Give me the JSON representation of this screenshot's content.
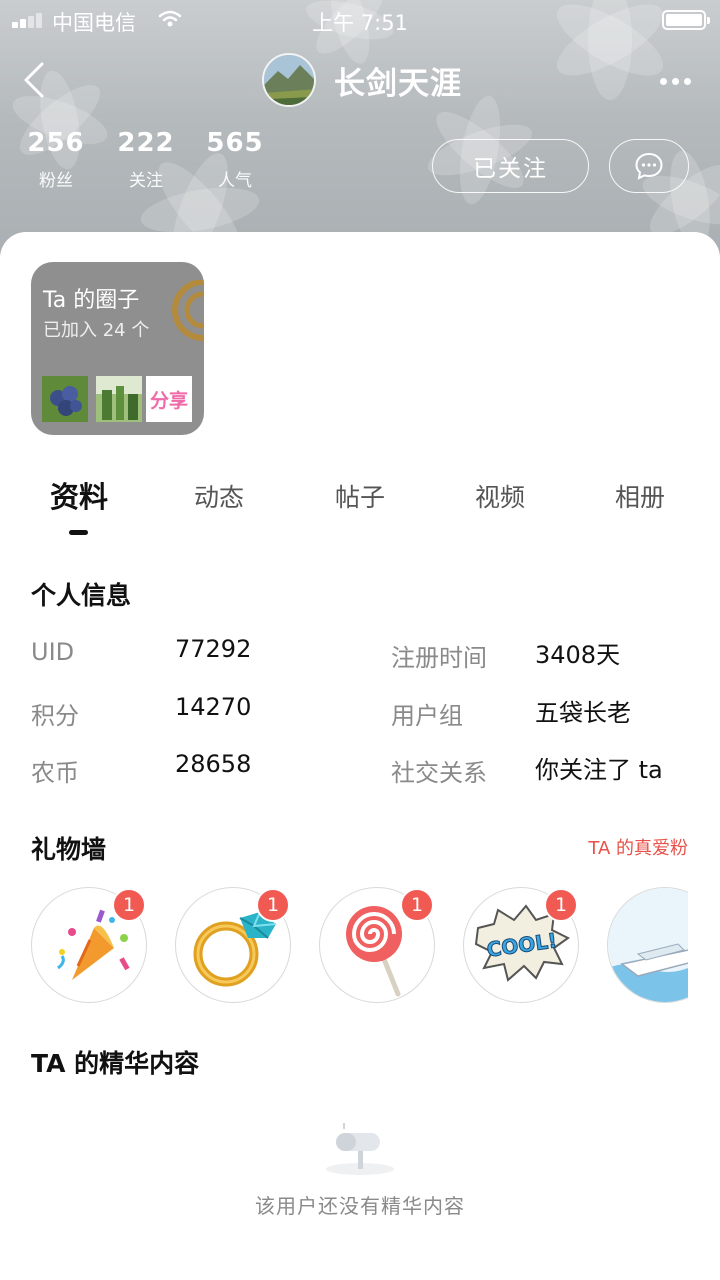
{
  "status_bar": {
    "carrier": "中国电信",
    "time": "上午 7:51"
  },
  "profile": {
    "username": "长剑天涯"
  },
  "stats": [
    {
      "value": "256",
      "label": "粉丝"
    },
    {
      "value": "222",
      "label": "关注"
    },
    {
      "value": "565",
      "label": "人气"
    }
  ],
  "actions": {
    "follow_label": "已关注"
  },
  "circle": {
    "title": "Ta 的圈子",
    "subtitle": "已加入 24 个",
    "thumb3_text": "分享"
  },
  "tabs": [
    "资料",
    "动态",
    "帖子",
    "视频",
    "相册"
  ],
  "active_tab": "资料",
  "personal_info": {
    "title": "个人信息",
    "rows": [
      {
        "label": "UID",
        "value": "77292"
      },
      {
        "label": "积分",
        "value": "14270"
      },
      {
        "label": "农币",
        "value": "28658"
      },
      {
        "label": "注册时间",
        "value": "3408天"
      },
      {
        "label": "用户组",
        "value": "五袋长老"
      },
      {
        "label": "社交关系",
        "value": "你关注了 ta"
      }
    ]
  },
  "gift_wall": {
    "title": "礼物墙",
    "fans_link": "TA 的真爱粉",
    "gifts": [
      {
        "name": "party-popper",
        "count": "1"
      },
      {
        "name": "diamond-ring",
        "count": "1"
      },
      {
        "name": "lollipop",
        "count": "1"
      },
      {
        "name": "cool-sticker",
        "count": "1",
        "text": "COOL!"
      },
      {
        "name": "yacht"
      }
    ]
  },
  "featured": {
    "title": "TA 的精华内容",
    "empty_text": "该用户还没有精华内容"
  },
  "colors": {
    "accent_red": "#f05a52",
    "link_red": "#e8524a",
    "header_gray": "#b5babd"
  }
}
